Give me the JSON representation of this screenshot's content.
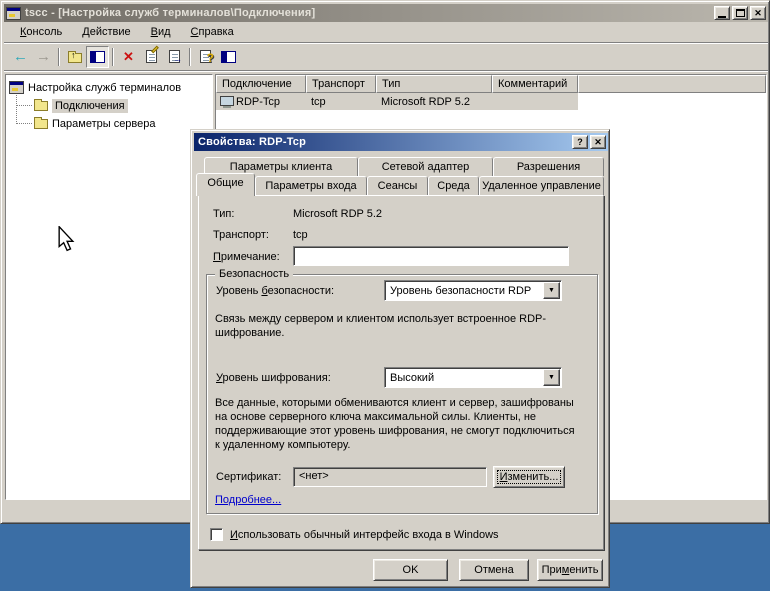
{
  "colors": {
    "desktop": "#3B6EA5",
    "window_face": "#D4D0C8",
    "active_title_start": "#0A246A",
    "active_title_end": "#A6CAF0",
    "inactive_title_start": "#6F6B64",
    "inactive_title_end": "#BBB7AE",
    "link": "#0000CC",
    "delete_red": "#CC1111",
    "back_teal": "#2FA8B8"
  },
  "icons": {
    "back": "←",
    "forward": "→",
    "up": "↑",
    "delete": "✕",
    "question": "?",
    "close": "✕",
    "dropdown": "▼",
    "panel_arrow": "▶",
    "export_arrow": "→"
  },
  "main_window": {
    "title": "tscc - [Настройка служб терминалов\\Подключения]",
    "menu": [
      {
        "key": "К",
        "rest": "онсоль"
      },
      {
        "key": "Д",
        "rest": "ействие"
      },
      {
        "key": "В",
        "rest": "ид"
      },
      {
        "key": "С",
        "rest": "правка"
      }
    ],
    "tree": {
      "root": "Настройка служб терминалов",
      "items": [
        {
          "label": "Подключения"
        },
        {
          "label": "Параметры сервера"
        }
      ]
    },
    "list": {
      "columns": [
        "Подключение",
        "Транспорт",
        "Тип",
        "Комментарий"
      ],
      "rows": [
        {
          "name": "RDP-Tcp",
          "transport": "tcp",
          "type": "Microsoft RDP 5.2",
          "comment": ""
        }
      ]
    }
  },
  "dialog": {
    "title": "Свойства: RDP-Tcp",
    "tabs_back": [
      "Параметры клиента",
      "Сетевой адаптер",
      "Разрешения"
    ],
    "tabs_front": [
      {
        "label": "Общие"
      },
      {
        "label": "Параметры входа"
      },
      {
        "label": "Сеансы"
      },
      {
        "label": "Среда"
      },
      {
        "label": "Удаленное управление"
      }
    ],
    "general": {
      "type_label": "Тип:",
      "type_value": "Microsoft RDP 5.2",
      "transport_label": "Транспорт:",
      "transport_value": "tcp",
      "comment_label": {
        "key": "П",
        "rest": "римечание:"
      },
      "comment_value": "",
      "security": {
        "title": "Безопасность",
        "level_label": {
          "pre": "Уровень ",
          "key": "б",
          "rest": "езопасности:"
        },
        "level_value": "Уровень безопасности RDP",
        "level_desc": "Связь между сервером и клиентом использует встроенное RDP-шифрование.",
        "enc_label": {
          "pre": "",
          "key": "У",
          "rest": "ровень шифрования:"
        },
        "enc_value": "Высокий",
        "enc_desc": "Все данные, которыми обмениваются клиент и сервер, зашифрованы на основе серверного ключа максимальной силы. Клиенты, не поддерживающие этот уровень шифрования, не смогут подключиться к удаленному компьютеру.",
        "cert_label": "Сертификат:",
        "cert_value": "<нет>",
        "change_button": {
          "pre": "",
          "key": "И",
          "rest": "зменить..."
        },
        "more_link": "Подробнее..."
      },
      "checkbox_label": {
        "pre": "",
        "key": "И",
        "rest": "спользовать обычный интерфейс входа в Windows"
      }
    },
    "buttons": {
      "ok": "OK",
      "cancel": "Отмена",
      "apply": {
        "pre": "При",
        "key": "м",
        "rest": "енить"
      }
    }
  }
}
